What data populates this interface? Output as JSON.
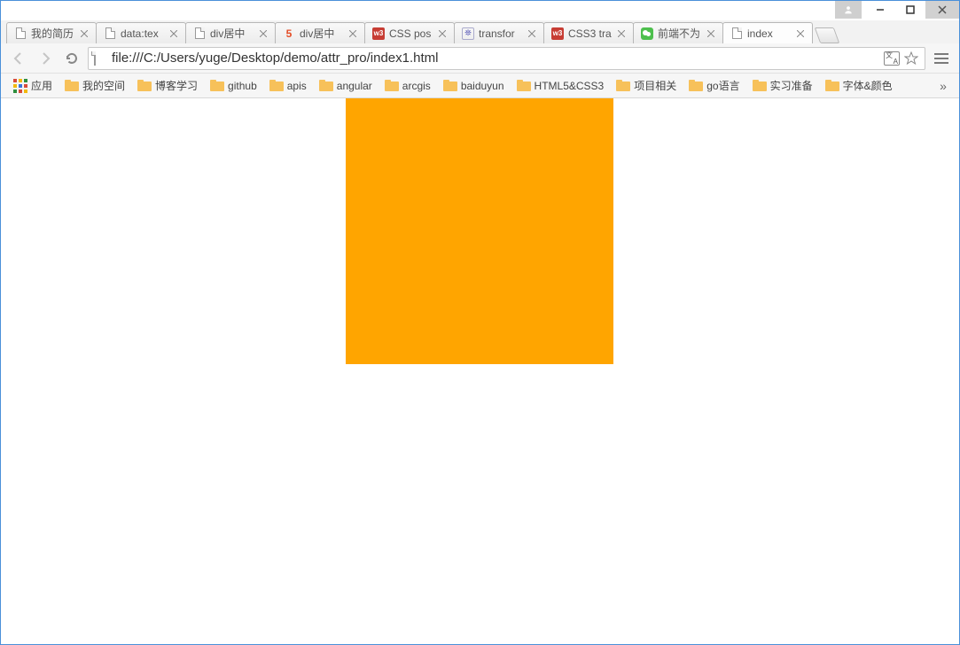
{
  "window_controls": {
    "user": "user",
    "minimize": "—",
    "maximize": "☐",
    "close": "✕"
  },
  "tabs": [
    {
      "title": "我的简历",
      "favicon": "page"
    },
    {
      "title": "data:tex",
      "favicon": "page"
    },
    {
      "title": "div居中",
      "favicon": "page"
    },
    {
      "title": "div居中",
      "favicon": "h5"
    },
    {
      "title": "CSS pos",
      "favicon": "w3"
    },
    {
      "title": "transfor",
      "favicon": "baidu"
    },
    {
      "title": "CSS3 tra",
      "favicon": "w3"
    },
    {
      "title": "前端不为",
      "favicon": "wx"
    },
    {
      "title": "index",
      "favicon": "page",
      "active": true
    }
  ],
  "address_bar": {
    "url": "file:///C:/Users/yuge/Desktop/demo/attr_pro/index1.html"
  },
  "bookmarks": {
    "apps_label": "应用",
    "items": [
      "我的空间",
      "博客学习",
      "github",
      "apis",
      "angular",
      "arcgis",
      "baiduyun",
      "HTML5&CSS3",
      "项目相关",
      "go语言",
      "实习准备",
      "字体&颜色"
    ],
    "overflow": "»"
  },
  "page": {
    "box_color": "#ffa500"
  }
}
